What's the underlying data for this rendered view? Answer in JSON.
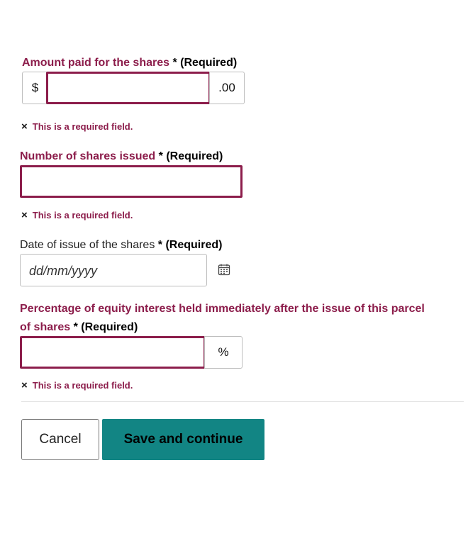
{
  "amount": {
    "label": "Amount paid for the shares",
    "required_star": "*",
    "required_text": "(Required)",
    "prefix": "$",
    "suffix": ".00",
    "value": "",
    "error": "This is a required field."
  },
  "shares": {
    "label": "Number of shares issued",
    "required_star": "*",
    "required_text": "(Required)",
    "value": "",
    "error": "This is a required field."
  },
  "date": {
    "label": "Date of issue of the shares",
    "required_star": "*",
    "required_text": "(Required)",
    "placeholder": "dd/mm/yyyy"
  },
  "percentage": {
    "label_line1": "Percentage of equity interest held immediately after the issue of this parcel",
    "label_line2": "of shares",
    "required_star": "*",
    "required_text": "(Required)",
    "suffix": "%",
    "value": "",
    "error": "This is a required field."
  },
  "error_icon": "×",
  "buttons": {
    "cancel": "Cancel",
    "save": "Save and continue"
  },
  "colors": {
    "error": "#8c1d4b",
    "primary_button": "#128584"
  }
}
